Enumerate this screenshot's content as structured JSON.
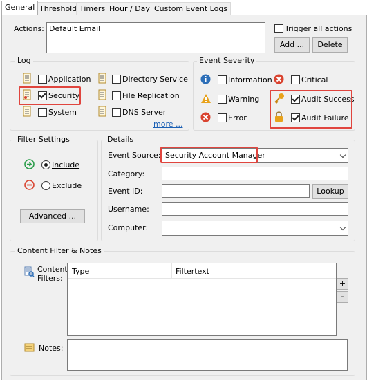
{
  "tabs": [
    "General",
    "Threshold",
    "Timers",
    "Hour / Day",
    "Custom Event Logs"
  ],
  "actions": {
    "label": "Actions:",
    "value": "Default Email",
    "trigger_all_label": "Trigger all actions",
    "add_label": "Add ...",
    "delete_label": "Delete"
  },
  "log": {
    "title": "Log",
    "items": [
      {
        "label": "Application",
        "checked": false
      },
      {
        "label": "Security",
        "checked": true
      },
      {
        "label": "System",
        "checked": false
      },
      {
        "label": "Directory Service",
        "checked": false
      },
      {
        "label": "File Replication",
        "checked": false
      },
      {
        "label": "DNS Server",
        "checked": false
      }
    ],
    "more_label": "more ..."
  },
  "event_severity": {
    "title": "Event Severity",
    "items": [
      {
        "label": "Information",
        "checked": false,
        "icon": "info-icon"
      },
      {
        "label": "Warning",
        "checked": false,
        "icon": "warning-icon"
      },
      {
        "label": "Error",
        "checked": false,
        "icon": "error-icon"
      },
      {
        "label": "Critical",
        "checked": false,
        "icon": "error-icon"
      },
      {
        "label": "Audit Success",
        "checked": true,
        "icon": "key-icon"
      },
      {
        "label": "Audit Failure",
        "checked": true,
        "icon": "lock-icon"
      }
    ]
  },
  "filter_settings": {
    "title": "Filter Settings",
    "include_label": "Include",
    "exclude_label": "Exclude",
    "selected": "Include",
    "advanced_label": "Advanced ..."
  },
  "details": {
    "title": "Details",
    "event_source_label": "Event Source:",
    "event_source_value": "Security Account Manager",
    "category_label": "Category:",
    "event_id_label": "Event ID:",
    "lookup_label": "Lookup",
    "username_label": "Username:",
    "computer_label": "Computer:"
  },
  "content_filter": {
    "title": "Content Filter & Notes",
    "filters_label": "Content Filters:",
    "columns": [
      "Type",
      "Filtertext"
    ],
    "notes_label": "Notes:"
  },
  "colors": {
    "highlight": "#e0453e",
    "info": "#2d6fb8",
    "error": "#d9432f",
    "warning": "#e8a21b",
    "include": "#2a9d4a",
    "exclude": "#d9432f",
    "link": "#1a5fb4"
  }
}
